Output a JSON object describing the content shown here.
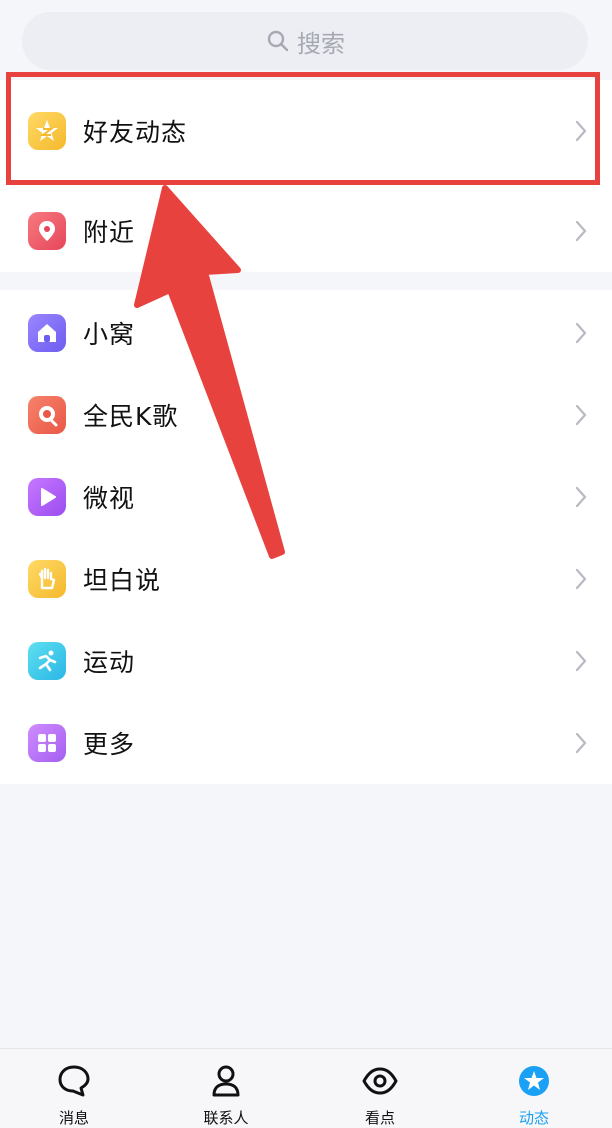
{
  "search": {
    "placeholder": "搜索"
  },
  "group1": [
    {
      "label": "好友动态",
      "icon": "qzone-star-icon",
      "color": "#f6c445"
    },
    {
      "label": "附近",
      "icon": "location-pin-icon",
      "color": "#ee5a66"
    }
  ],
  "group2": [
    {
      "label": "小窝",
      "icon": "house-icon",
      "color": "#7e6ef0"
    },
    {
      "label": "全民K歌",
      "icon": "karaoke-icon",
      "color": "#f06a56"
    },
    {
      "label": "微视",
      "icon": "play-icon",
      "color": "#b05cf0"
    },
    {
      "label": "坦白说",
      "icon": "hand-icon",
      "color": "#f6c445"
    },
    {
      "label": "运动",
      "icon": "running-icon",
      "color": "#34c8e8"
    },
    {
      "label": "更多",
      "icon": "grid-icon",
      "color": "#b46cf0"
    }
  ],
  "tabbar": [
    {
      "label": "消息",
      "icon": "message-bubble-icon"
    },
    {
      "label": "联系人",
      "icon": "contact-person-icon"
    },
    {
      "label": "看点",
      "icon": "eye-icon"
    },
    {
      "label": "动态",
      "icon": "star-dynamic-icon",
      "active": true
    }
  ],
  "accent_color": "#e8423f"
}
